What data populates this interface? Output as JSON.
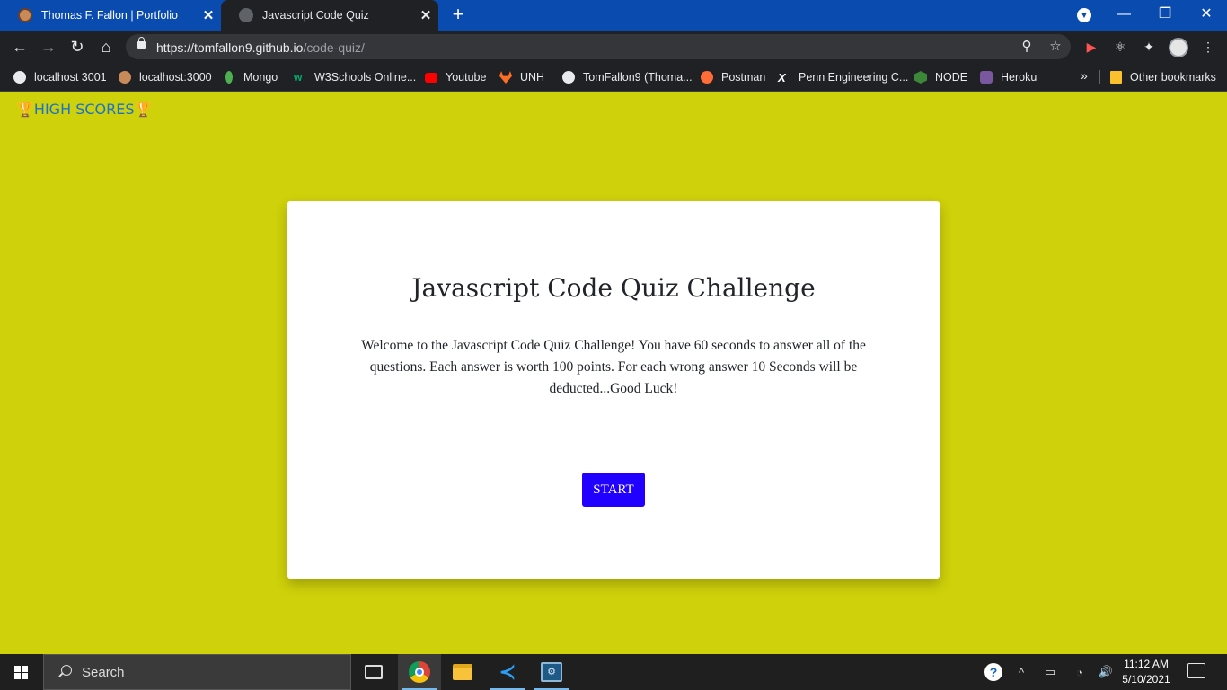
{
  "browser": {
    "tabs": [
      {
        "title": "Thomas F. Fallon | Portfolio",
        "active": false
      },
      {
        "title": "Javascript Code Quiz",
        "active": true
      }
    ],
    "new_tab": "+",
    "window_controls": {
      "minimize": "—",
      "maximize": "❐",
      "close": "✕"
    },
    "tab_close": "✕",
    "url_host": "https://tomfallon9.github.io",
    "url_path": "/code-quiz/",
    "nav": {
      "back": "←",
      "forward": "→",
      "reload": "↻",
      "home": "⌂"
    },
    "omnibox_icons": {
      "zoom": "⚲",
      "star": "☆"
    },
    "extensions": {
      "ext1": "▶",
      "react": "⚛",
      "puzzle": "✦",
      "menu": "⋮"
    }
  },
  "bookmarks": {
    "items": [
      {
        "label": "localhost 3001",
        "icon": "globe-icon",
        "color": "#e8eaed"
      },
      {
        "label": "localhost:3000",
        "icon": "avatar-icon",
        "color": "#c98a5a"
      },
      {
        "label": "Mongo",
        "icon": "mongo-leaf-icon",
        "color": "#4caf50"
      },
      {
        "label": "W3Schools Online...",
        "icon": "w3schools-icon",
        "color": "#04aa6d"
      },
      {
        "label": "Youtube",
        "icon": "youtube-icon",
        "color": "#ff0000"
      },
      {
        "label": "UNH",
        "icon": "gitlab-icon",
        "color": "#fc6d26"
      },
      {
        "label": "TomFallon9 (Thoma...",
        "icon": "github-icon",
        "color": "#e8eaed"
      },
      {
        "label": "Postman",
        "icon": "postman-icon",
        "color": "#ff6c37"
      },
      {
        "label": "Penn Engineering C...",
        "icon": "penn-x-icon",
        "color": "#ffffff"
      },
      {
        "label": "NODE",
        "icon": "node-icon",
        "color": "#3c873a"
      },
      {
        "label": "Heroku",
        "icon": "heroku-icon",
        "color": "#79589f"
      }
    ],
    "more": "»",
    "other": "Other bookmarks"
  },
  "page": {
    "high_scores": "HIGH SCORES",
    "trophy": "🏆",
    "title": "Javascript Code Quiz Challenge",
    "intro": "Welcome to the Javascript Code Quiz Challenge! You have 60 seconds to answer all of the questions. Each answer is worth 100 points. For each wrong answer 10 Seconds will be deducted...Good Luck!",
    "start_label": "START",
    "background_color": "#cfd10a",
    "button_color": "#2200ff"
  },
  "taskbar": {
    "search_placeholder": "Search",
    "time": "11:12 AM",
    "date": "5/10/2021",
    "help": "?",
    "tray_chevron": "^",
    "volume": "🔊"
  }
}
